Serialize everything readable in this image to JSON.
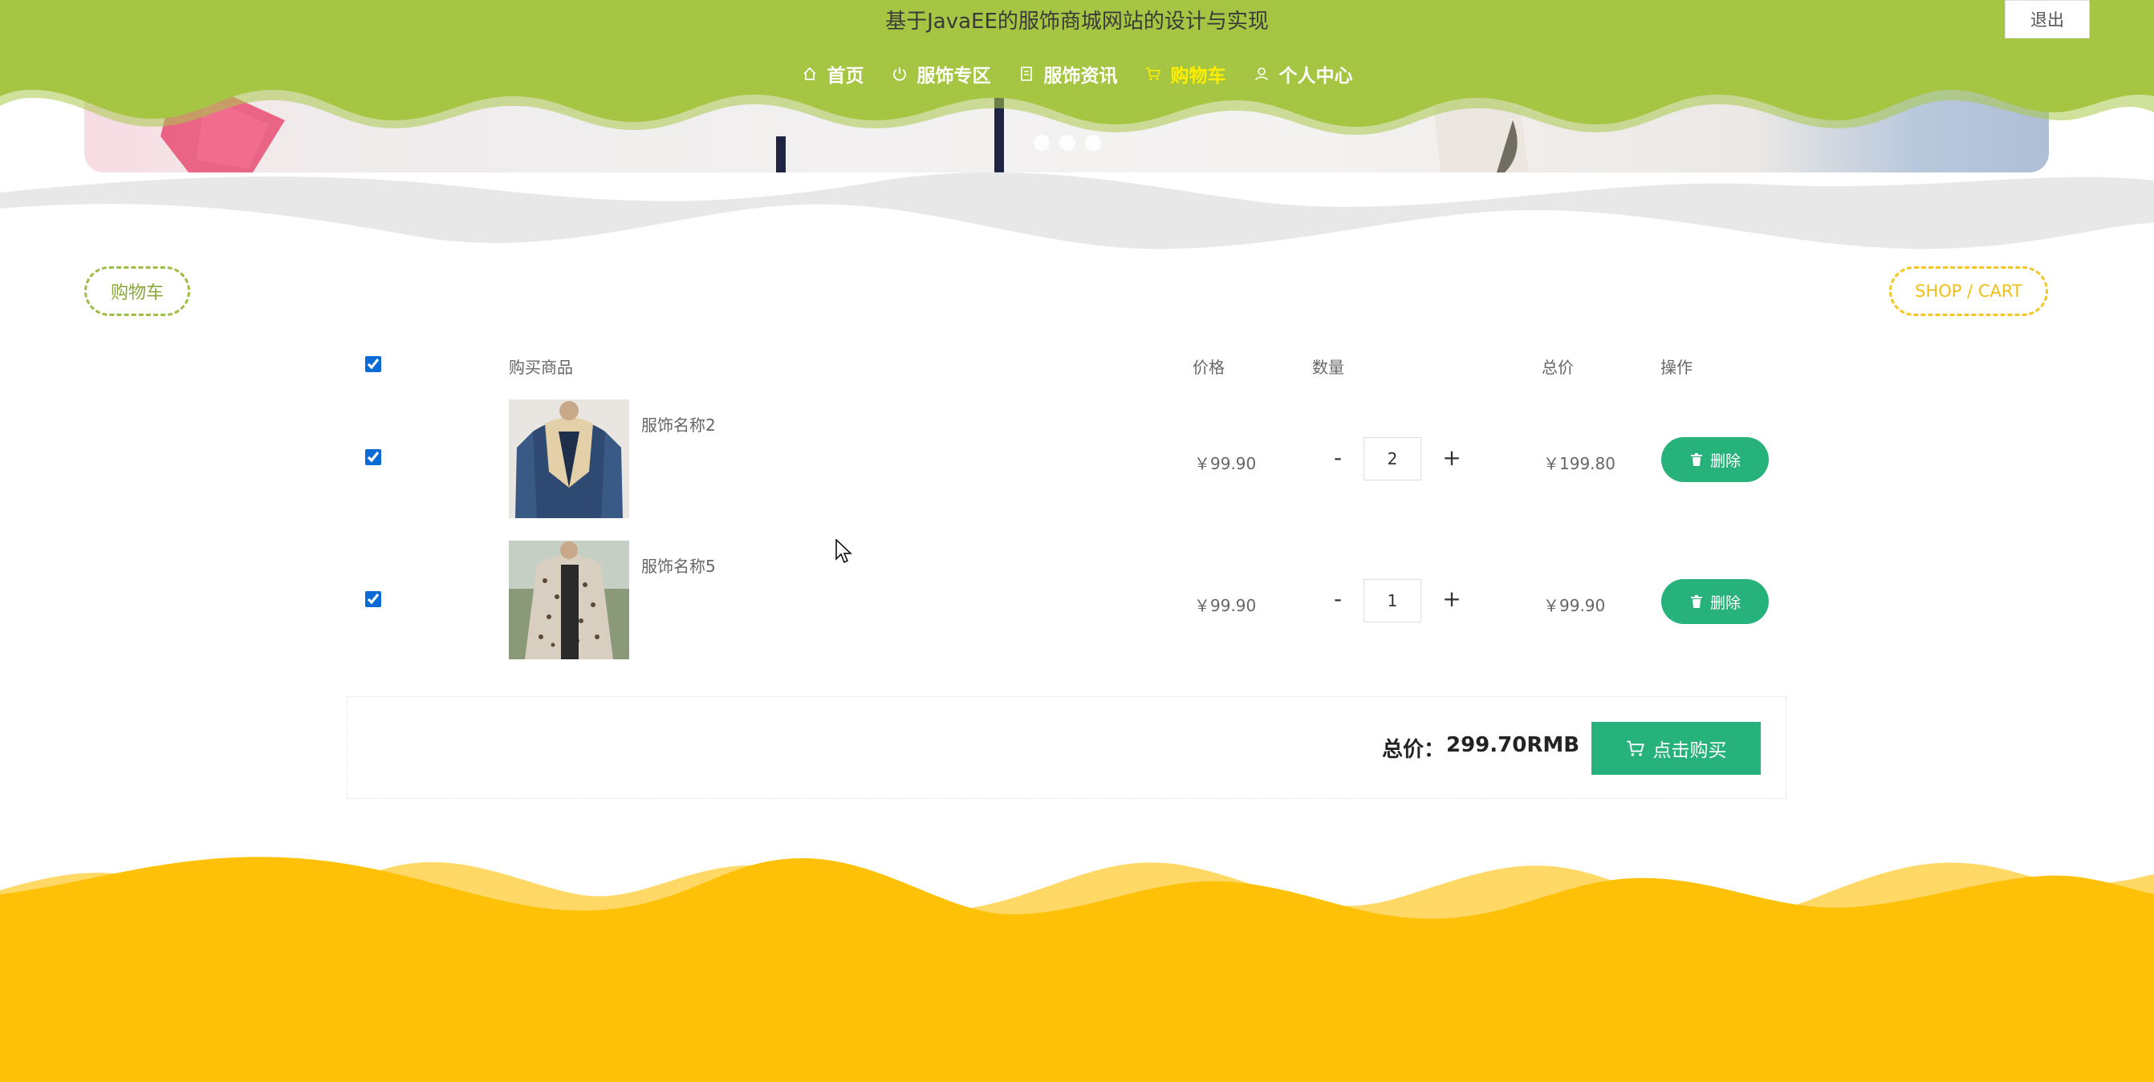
{
  "header": {
    "title": "基于JavaEE的服饰商城网站的设计与实现",
    "logout_label": "退出",
    "nav": [
      {
        "label": "首页",
        "icon": "home-icon"
      },
      {
        "label": "服饰专区",
        "icon": "power-icon"
      },
      {
        "label": "服饰资讯",
        "icon": "document-icon"
      },
      {
        "label": "购物车",
        "icon": "cart-icon",
        "active": true
      },
      {
        "label": "个人中心",
        "icon": "user-icon"
      }
    ]
  },
  "section": {
    "title_cn": "购物车",
    "title_en": "SHOP / CART"
  },
  "cart": {
    "headers": {
      "product": "购买商品",
      "price": "价格",
      "quantity": "数量",
      "total": "总价",
      "action": "操作"
    },
    "items": [
      {
        "name": "服饰名称2",
        "price": "￥99.90",
        "qty": "2",
        "subtotal": "￥199.80",
        "delete_label": "删除",
        "checked": true
      },
      {
        "name": "服饰名称5",
        "price": "￥99.90",
        "qty": "1",
        "subtotal": "￥99.90",
        "delete_label": "删除",
        "checked": true
      }
    ],
    "minus": "-",
    "plus": "+",
    "total_label": "总价：",
    "total_value": "299.70RMB",
    "buy_label": "点击购买"
  },
  "colors": {
    "header_green": "#a5c543",
    "accent_green": "#27b27c",
    "footer_yellow": "#ffc107",
    "nav_active": "#ffee00"
  }
}
